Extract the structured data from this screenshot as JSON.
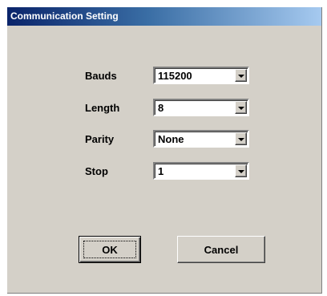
{
  "window": {
    "title": "Communication Setting"
  },
  "fields": [
    {
      "label": "Bauds",
      "value": "115200"
    },
    {
      "label": "Length",
      "value": "8"
    },
    {
      "label": "Parity",
      "value": "None"
    },
    {
      "label": "Stop",
      "value": "1"
    }
  ],
  "buttons": {
    "ok": "OK",
    "cancel": "Cancel"
  }
}
